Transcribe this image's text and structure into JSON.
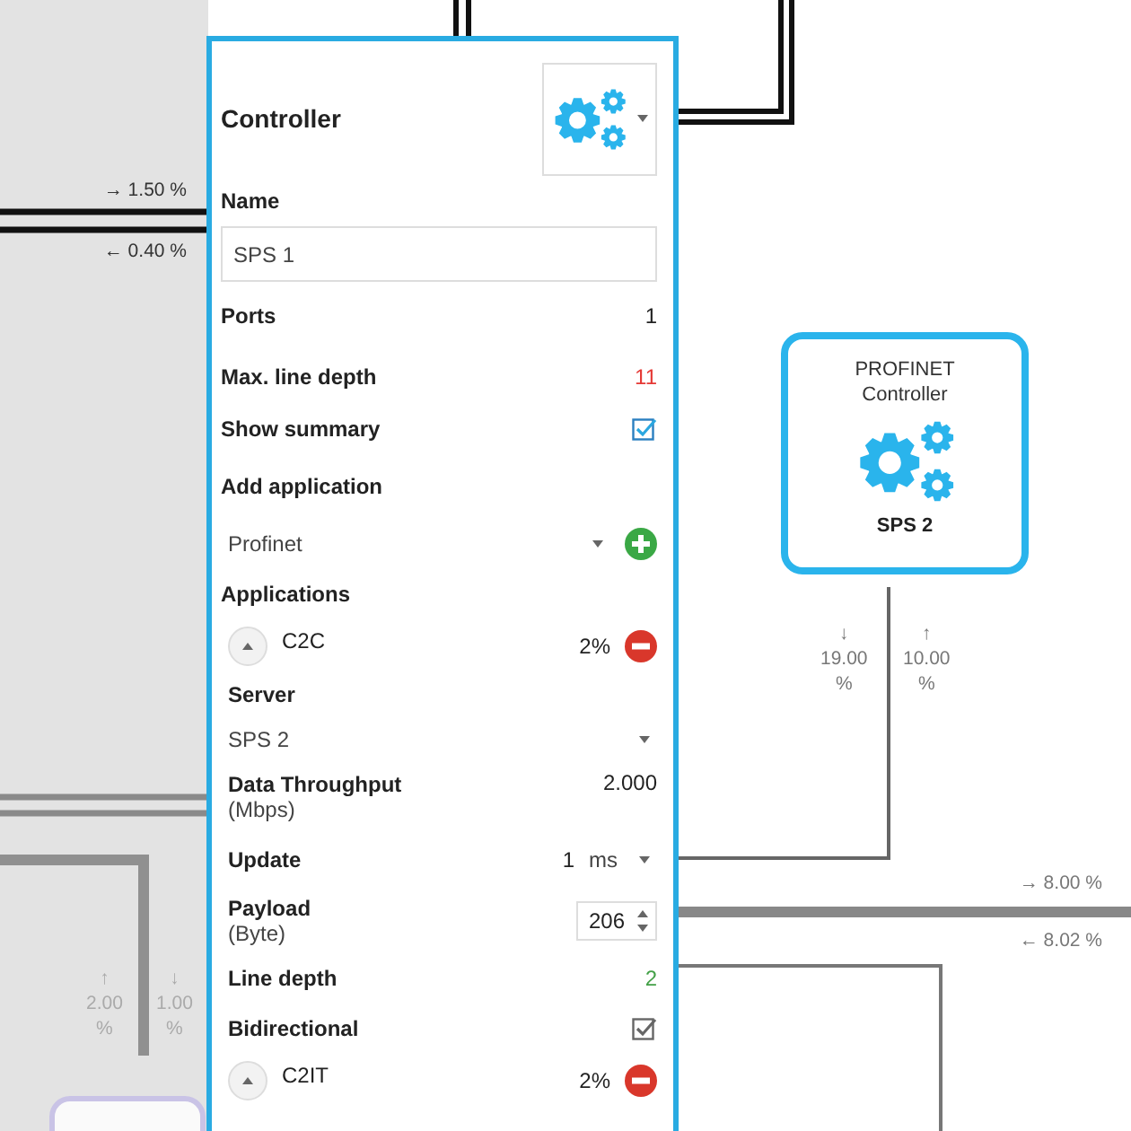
{
  "diagram": {
    "node": {
      "type": "PROFINET Controller",
      "name": "SPS 2",
      "selected": true
    },
    "link_labels": [
      "→ 1.50 %",
      "← 0.40 %",
      "↓ 19.00 %",
      "↑ 10.00 %",
      "→ 8.00 %",
      "← 8.02 %",
      "↑ 2.00 %",
      "↓ 1.00 %"
    ]
  },
  "panel": {
    "title": "Controller",
    "name_label": "Name",
    "name_value": "SPS 1",
    "properties": [
      {
        "kind": "value",
        "label": "Ports",
        "value": "1"
      },
      {
        "kind": "value",
        "label": "Max. line depth",
        "value": "11",
        "color": "#e53935"
      },
      {
        "kind": "checkbox",
        "label": "Show summary",
        "checked": true,
        "focused": true
      }
    ],
    "add_application": {
      "label": "Add application",
      "value": "Profinet"
    },
    "applications_label": "Applications",
    "applications": [
      {
        "name": "C2C",
        "share": "2%",
        "fields": [
          {
            "kind": "select",
            "label": "Server",
            "value": "SPS 2"
          },
          {
            "kind": "value",
            "label": "Data Throughput",
            "unit": "(Mbps)",
            "value": "2.000"
          },
          {
            "kind": "unit_select",
            "label": "Update",
            "value": "1",
            "unit_value": "ms"
          },
          {
            "kind": "spinner",
            "label": "Payload",
            "unit": "(Byte)",
            "value": "206"
          },
          {
            "kind": "value",
            "label": "Line depth",
            "value": "2",
            "color": "#43a047"
          },
          {
            "kind": "checkbox",
            "label": "Bidirectional",
            "checked": true,
            "focused": false
          }
        ]
      },
      {
        "name": "C2IT",
        "share": "2%"
      }
    ]
  }
}
